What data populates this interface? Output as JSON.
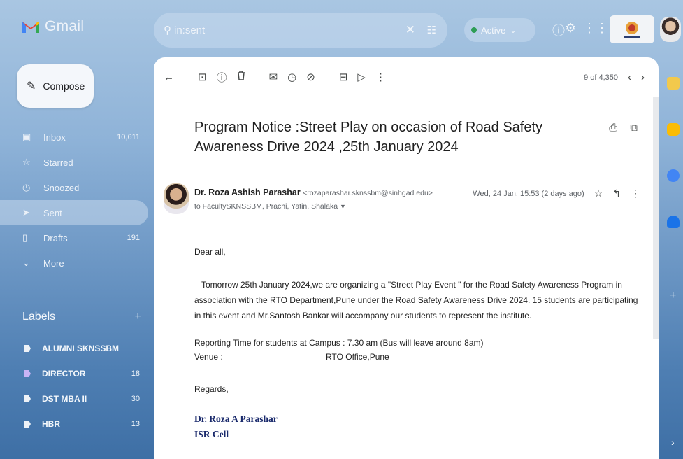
{
  "app": {
    "name": "Gmail"
  },
  "search": {
    "query": "in:sent"
  },
  "status": {
    "label": "Active",
    "color": "#2e9d56"
  },
  "icons": {
    "clear": "close-icon",
    "tune": "tune-icon",
    "help": "help-icon",
    "settings": "gear-icon",
    "apps": "apps-grid-icon"
  },
  "compose": {
    "label": "Compose"
  },
  "sidebar": {
    "items": [
      {
        "label": "Inbox",
        "count": "10,611",
        "icon": "inbox-icon",
        "glyph": "▣"
      },
      {
        "label": "Starred",
        "count": "",
        "icon": "star-icon",
        "glyph": "☆"
      },
      {
        "label": "Snoozed",
        "count": "",
        "icon": "clock-icon",
        "glyph": "◷"
      },
      {
        "label": "Sent",
        "count": "",
        "icon": "send-icon",
        "glyph": "➤"
      },
      {
        "label": "Drafts",
        "count": "191",
        "icon": "draft-icon",
        "glyph": "▯"
      },
      {
        "label": "More",
        "count": "",
        "icon": "chevron-down-icon",
        "glyph": "⌄"
      }
    ],
    "active": "Sent",
    "labels_heading": "Labels",
    "labels_add": "+",
    "labels": [
      {
        "name": "ALUMNI SKNSSBM",
        "count": "",
        "color": "#eef2f7"
      },
      {
        "name": "DIRECTOR",
        "count": "18",
        "color": "#c9b3f5"
      },
      {
        "name": "DST MBA II",
        "count": "30",
        "color": "#eef2f7"
      },
      {
        "name": "HBR",
        "count": "13",
        "color": "#eef2f7"
      }
    ]
  },
  "toolbar": {
    "icons": [
      {
        "name": "back-icon",
        "glyph": "←"
      },
      {
        "name": "archive-icon",
        "glyph": "⊡"
      },
      {
        "name": "report-spam-icon",
        "glyph": "ⓘ"
      },
      {
        "name": "delete-icon",
        "glyph": "🗑"
      },
      {
        "name": "mark-unread-icon",
        "glyph": "✉"
      },
      {
        "name": "snooze-icon",
        "glyph": "◷"
      },
      {
        "name": "add-task-icon",
        "glyph": "⊘"
      },
      {
        "name": "move-to-icon",
        "glyph": "⊟"
      },
      {
        "name": "label-icon",
        "glyph": "▷"
      },
      {
        "name": "more-vert-icon",
        "glyph": "⋮"
      }
    ],
    "pager": "9 of 4,350",
    "prev": "‹",
    "next": "›"
  },
  "email": {
    "subject": "Program Notice :Street Play on occasion of Road Safety Awareness Drive 2024 ,25th January 2024",
    "sender_name": "Dr. Roza Ashish Parashar",
    "sender_email": "<rozaparashar.sknssbm@sinhgad.edu>",
    "recipients": "to FacultySKNSSBM, Prachi, Yatin, Shalaka",
    "date": "Wed, 24 Jan, 15:53 (2 days ago)",
    "greeting": "Dear all,",
    "paragraph": "Tomorrow 25th January 2024,we are organizing a \"Street Play Event \" for the Road Safety Awareness Program in association with the RTO Department,Pune under the Road Safety Awareness Drive 2024. 15 students are participating in this event and Mr.Santosh Bankar will accompany our students to represent the institute.",
    "reporting_time": "Reporting Time for students at Campus : 7.30 am (Bus will leave around 8am)",
    "venue_key": "Venue :",
    "venue_value": "RTO Office,Pune",
    "regards": "Regards,",
    "signature_name": "Dr. Roza A Parashar",
    "signature_dept": "ISR Cell"
  }
}
